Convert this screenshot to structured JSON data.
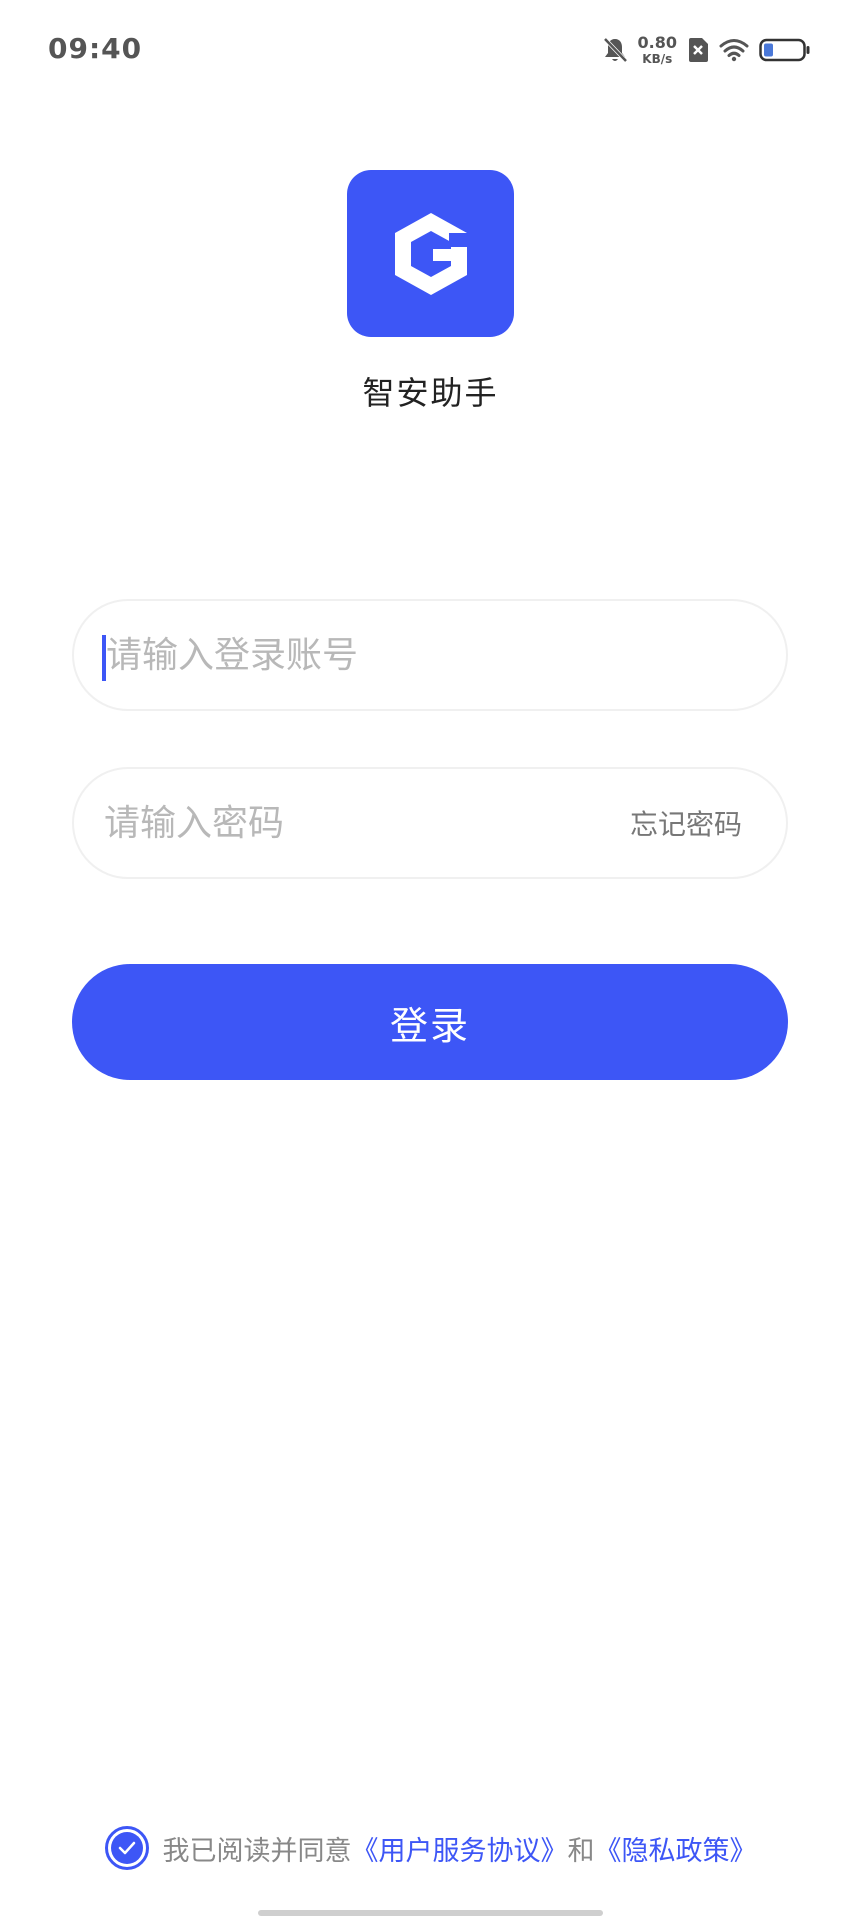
{
  "status_bar": {
    "time": "09:40",
    "net_speed_value": "0.80",
    "net_speed_unit": "KB/s",
    "icons": [
      "bell-muted-icon",
      "sim-x-icon",
      "wifi-icon",
      "battery-icon"
    ]
  },
  "app": {
    "name": "智安助手",
    "logo_icon": "hexagon-g-logo",
    "brand_color": "#3d56f6"
  },
  "form": {
    "account_placeholder": "请输入登录账号",
    "password_placeholder": "请输入密码",
    "forgot_label": "忘记密码",
    "login_label": "登录"
  },
  "agreement": {
    "prefix": "我已阅读并同意",
    "user_agreement": "《用户服务协议》",
    "conjunction": "和",
    "privacy_policy": "《隐私政策》",
    "checked": true
  }
}
